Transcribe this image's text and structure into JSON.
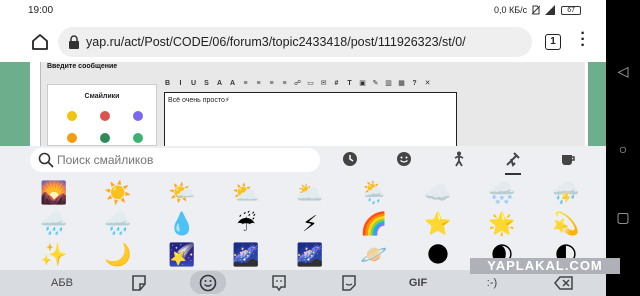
{
  "status": {
    "time": "19:00",
    "speed": "0,0 КБ/с",
    "battery": "67"
  },
  "browser": {
    "url": "yap.ru/act/Post/CODE/06/forum3/topic2433418/post/111926323/st/0/",
    "tab_count": "1"
  },
  "page": {
    "form_title": "Введите сообщение",
    "smileys_heading": "Смайлики",
    "toolbar_buttons": [
      "B",
      "I",
      "U",
      "S",
      "A",
      "A",
      "≡",
      "≡",
      "≡",
      "≡",
      "☍",
      "▭",
      "✉",
      "#",
      "T",
      "▣",
      "✎",
      "▥",
      "▦",
      "?",
      "✕"
    ],
    "editor_text": "Всё очень просто⚡"
  },
  "keyboard": {
    "search_placeholder": "Поиск смайликов",
    "categories": [
      "recent-clock-icon",
      "smiley-face-icon",
      "person-icon",
      "travel-places-icon",
      "objects-cup-icon"
    ],
    "emojis": [
      [
        "🌄",
        "☀️",
        "🌤️",
        "⛅",
        "🌥️",
        "🌦️",
        "☁️",
        "🌨️",
        "⛈️"
      ],
      [
        "🌧️",
        "🌧️",
        "💧",
        "☔",
        "⚡",
        "🌈",
        "⭐",
        "🌟",
        "💫"
      ],
      [
        "✨",
        "🌙",
        "🌠",
        "🌌",
        "🌌",
        "🪐",
        "🌑",
        "🌒",
        "🌓"
      ]
    ],
    "bottom": {
      "abc_label": "АБВ",
      "gif_label": "GIF",
      "emoticon_label": ":-)"
    }
  },
  "watermark": "YAPLAKAL.COM"
}
